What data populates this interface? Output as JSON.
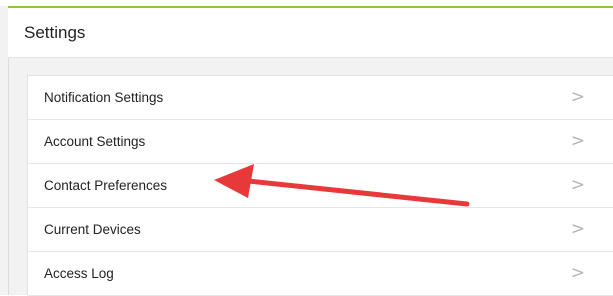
{
  "header": {
    "title": "Settings"
  },
  "menu": {
    "items": [
      {
        "label": "Notification Settings",
        "chevron": ">"
      },
      {
        "label": "Account Settings",
        "chevron": ">"
      },
      {
        "label": "Contact Preferences",
        "chevron": ">"
      },
      {
        "label": "Current Devices",
        "chevron": ">"
      },
      {
        "label": "Access Log",
        "chevron": ">"
      }
    ]
  },
  "annotation": {
    "type": "arrow",
    "points_to": "Contact Preferences",
    "color": "#e8393a"
  },
  "colors": {
    "accent": "#8cc63f",
    "chevron": "#b4b4b4",
    "text": "#222222"
  }
}
